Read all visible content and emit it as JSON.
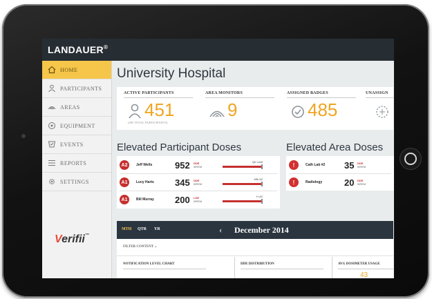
{
  "app": {
    "logo": "LANDAUER",
    "logo_mark": "®",
    "brand_prefix": "V",
    "brand_rest": "erifii",
    "brand_tm": "™"
  },
  "sidebar": {
    "items": [
      {
        "label": "HOME",
        "icon": "home-icon"
      },
      {
        "label": "PARTICIPANTS",
        "icon": "person-icon"
      },
      {
        "label": "AREAS",
        "icon": "area-icon"
      },
      {
        "label": "EQUIPMENT",
        "icon": "equipment-icon"
      },
      {
        "label": "EVENTS",
        "icon": "events-icon"
      },
      {
        "label": "REPORTS",
        "icon": "reports-icon"
      },
      {
        "label": "SETTINGS",
        "icon": "settings-icon"
      }
    ]
  },
  "page": {
    "title": "University Hospital"
  },
  "stats": {
    "active_label": "ACTIVE PARTICIPANTS",
    "active_value": "451",
    "active_sub": "(485 TOTAL PARTICIPANTS)",
    "area_label": "AREA MONITORS",
    "area_value": "9",
    "badges_label": "ASSIGNED BADGES",
    "badges_value": "485",
    "unassigned_label": "UNASSIGN"
  },
  "participants": {
    "title": "Elevated Participant Doses",
    "rows": [
      {
        "badge": "A2",
        "name": "Jeff Wells",
        "value": "952",
        "unit_top": "DDE",
        "unit_bottom": "MREM",
        "limit": "Qtr Limit"
      },
      {
        "badge": "A1",
        "name": "Lucy Harts",
        "value": "345",
        "unit_top": "DDE",
        "unit_bottom": "MREM",
        "limit": "Mth A2"
      },
      {
        "badge": "A1",
        "name": "Bill Murray",
        "value": "200",
        "unit_top": "LDE",
        "unit_bottom": "MREM",
        "limit": "Yr A2"
      }
    ]
  },
  "areas": {
    "title": "Elevated Area Doses",
    "rows": [
      {
        "icon": "!",
        "name": "Cath Lab #2",
        "value": "35",
        "unit_top": "DDE",
        "unit_bottom": "MREM"
      },
      {
        "icon": "!",
        "name": "Radiology",
        "value": "20",
        "unit_top": "DDE",
        "unit_bottom": "MREM"
      }
    ]
  },
  "period": {
    "tabs": [
      "MTH",
      "QTR",
      "YR"
    ],
    "active": "MTH",
    "prev": "‹",
    "month": "December 2014"
  },
  "filter": {
    "label": "FILTER CONTENT",
    "chevron": "⌄"
  },
  "columns": [
    "NOTIFICATION LEVEL CHART",
    "DDE DISTRIBUTION",
    "AVG DOSIMETER USAGE"
  ],
  "peek_value": "43",
  "colors": {
    "accent": "#f0a422",
    "danger": "#c62f2f",
    "nav": "#262d33",
    "active_nav": "#f5c64a"
  }
}
